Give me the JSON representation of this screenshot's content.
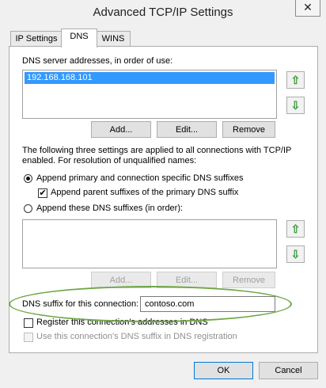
{
  "window": {
    "title": "Advanced TCP/IP Settings",
    "close_glyph": "✕"
  },
  "tabs": [
    {
      "label": "IP Settings"
    },
    {
      "label": "DNS"
    },
    {
      "label": "WINS"
    }
  ],
  "dns": {
    "servers_label": "DNS server addresses, in order of use:",
    "servers": [
      "192.168.168.101"
    ],
    "add_label": "Add...",
    "edit_label": "Edit...",
    "remove_label": "Remove",
    "info_line1": "The following three settings are applied to all connections with TCP/IP",
    "info_line2": "enabled. For resolution of unqualified names:",
    "append_primary_label": "Append primary and connection specific DNS suffixes",
    "append_parent_label": "Append parent suffixes of the primary DNS suffix",
    "append_these_label": "Append these DNS suffixes (in order):",
    "suffix_add_label": "Add...",
    "suffix_edit_label": "Edit...",
    "suffix_remove_label": "Remove",
    "conn_suffix_label": "DNS suffix for this connection:",
    "conn_suffix_value": "contoso.com",
    "register_label": "Register this connection's addresses in DNS",
    "use_suffix_label": "Use this connection's DNS suffix in DNS registration"
  },
  "footer": {
    "ok_label": "OK",
    "cancel_label": "Cancel"
  },
  "colors": {
    "accent_selection": "#3399ff",
    "annotation_ellipse": "#6fa745",
    "arrow_green": "#3d9a3d"
  }
}
